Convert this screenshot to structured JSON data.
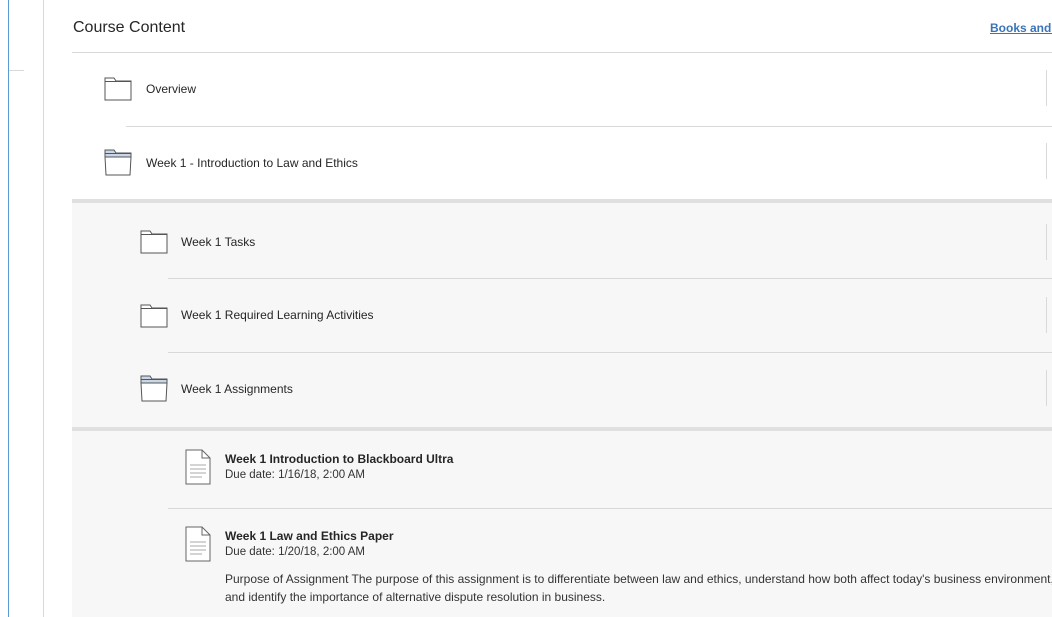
{
  "header": {
    "title": "Course Content",
    "link": "Books and Tools"
  },
  "folders": [
    {
      "label": "Overview",
      "state": "closed"
    },
    {
      "label": "Week 1 - Introduction to Law and Ethics",
      "state": "open"
    }
  ],
  "subfolders": [
    {
      "label": "Week 1 Tasks",
      "state": "closed"
    },
    {
      "label": "Week 1 Required Learning Activities",
      "state": "closed"
    },
    {
      "label": "Week 1 Assignments",
      "state": "open"
    }
  ],
  "assignments": [
    {
      "title": "Week 1 Introduction to Blackboard Ultra",
      "due": "Due date: 1/16/18, 2:00 AM"
    },
    {
      "title": "Week 1 Law and Ethics Paper",
      "due": "Due date: 1/20/18, 2:00 AM",
      "description": "Purpose of Assignment The purpose of this assignment is to differentiate between law and ethics, understand how both affect today's business environment, and identify the importance of alternative dispute resolution in business."
    }
  ],
  "icons": {
    "folder_closed": "folder-icon",
    "folder_open": "folder-open-icon",
    "document": "document-icon"
  },
  "colors": {
    "link": "#3a74b8",
    "window_border": "#5b9bd5",
    "panel_bg": "#f7f7f7"
  }
}
